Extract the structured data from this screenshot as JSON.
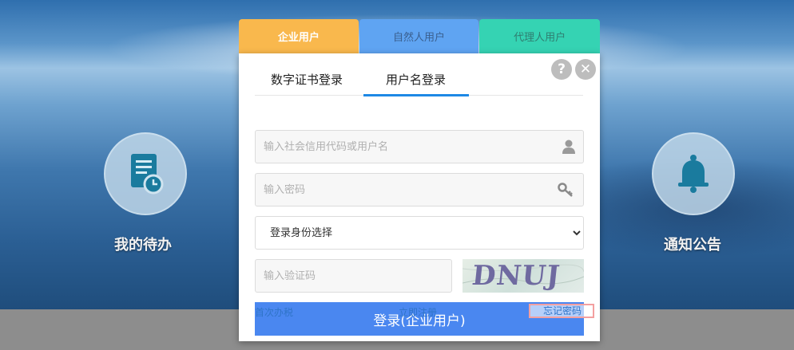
{
  "user_tabs": [
    "企业用户",
    "自然人用户",
    "代理人用户"
  ],
  "login_tabs": [
    "数字证书登录",
    "用户名登录"
  ],
  "fields": {
    "username_placeholder": "输入社会信用代码或用户名",
    "password_placeholder": "输入密码",
    "role_selected": "登录身份选择",
    "captcha_placeholder": "输入验证码",
    "captcha_text": "DNUJ"
  },
  "submit_label": "登录(企业用户)",
  "links": {
    "first_time": "首次办税",
    "register": "立即注册",
    "forgot": "忘记密码"
  },
  "features": {
    "left_label": "我的待办",
    "right_label": "通知公告"
  },
  "icons": {
    "help": "?",
    "close": "✕"
  },
  "colors": {
    "tab_enterprise": "#f9b84d",
    "tab_natural": "#5fa4f2",
    "tab_agent": "#35d3b3",
    "submit": "#4a87f0",
    "active_underline": "#1e88e5"
  }
}
